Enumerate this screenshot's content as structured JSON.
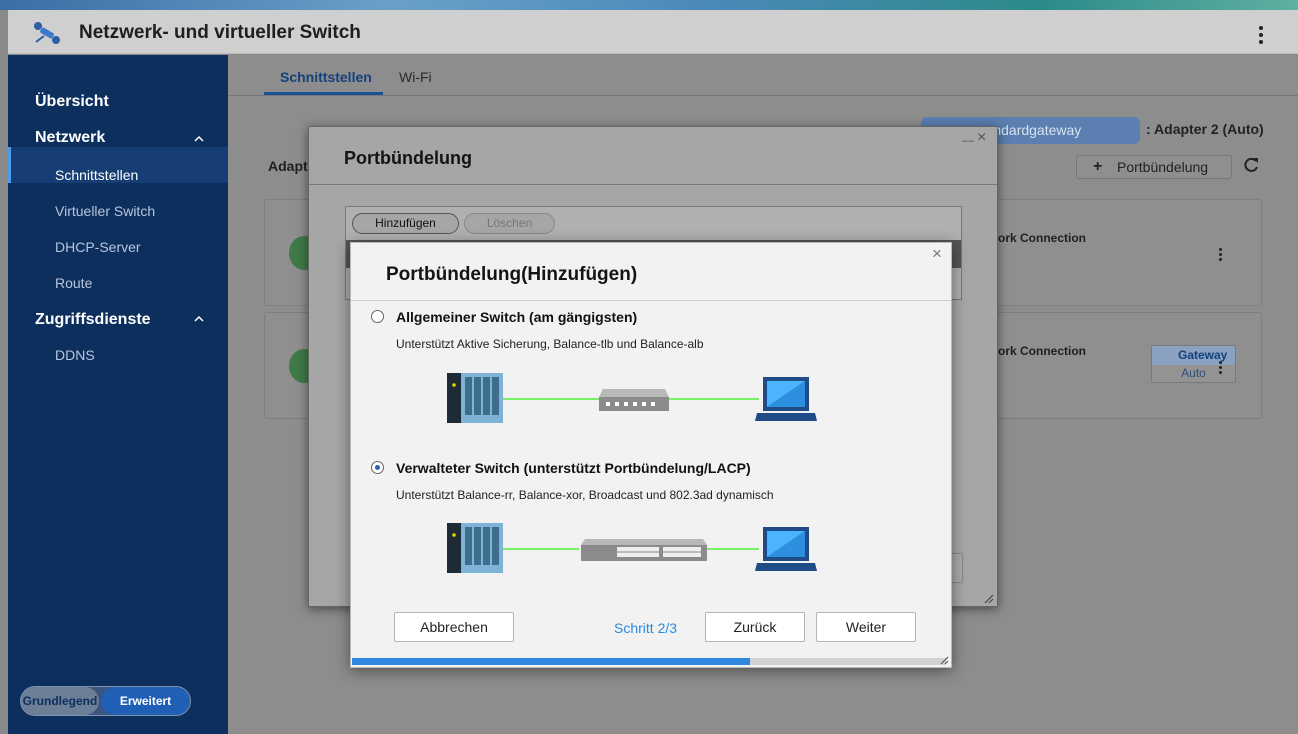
{
  "app": {
    "title": "Netzwerk- und virtueller Switch"
  },
  "sidebar": {
    "sections": [
      {
        "label": "Übersicht"
      },
      {
        "label": "Netzwerk"
      },
      {
        "label": "Zugriffsdienste"
      }
    ],
    "items": [
      {
        "label": "Schnittstellen",
        "active": true
      },
      {
        "label": "Virtueller Switch"
      },
      {
        "label": "DHCP-Server"
      },
      {
        "label": "Route"
      },
      {
        "label": "DDNS"
      }
    ],
    "mode_toggle": {
      "left": "Grundlegend",
      "right": "Erweitert",
      "selected": "Erweitert"
    }
  },
  "main": {
    "tabs": [
      {
        "label": "Schnittstellen",
        "active": true
      },
      {
        "label": "Wi-Fi"
      }
    ],
    "gateway_label": "mstandardgateway",
    "gateway_value": ": Adapter 2 (Auto)",
    "add_button": "Portbündelung",
    "adapter_heading": "Adapt",
    "cards": [
      {
        "connection": "ork Connection"
      },
      {
        "connection": "ork Connection",
        "badge_title": "Gateway",
        "badge_sub": "Auto"
      }
    ]
  },
  "dialog_bond": {
    "title": "Portbündelung",
    "add_button": "Hinzufügen",
    "delete_button": "Löschen"
  },
  "dialog_add": {
    "title": "Portbündelung(Hinzufügen)",
    "options": [
      {
        "title": "Allgemeiner Switch (am gängigsten)",
        "desc": "Unterstützt Aktive Sicherung, Balance-tlb und Balance-alb",
        "selected": false
      },
      {
        "title": "Verwalteter Switch (unterstützt Portbündelung/LACP)",
        "desc": "Unterstützt Balance-rr, Balance-xor, Broadcast und 802.3ad dynamisch",
        "selected": true
      }
    ],
    "cancel_button": "Abbrechen",
    "step_text": "Schritt 2/3",
    "back_button": "Zurück",
    "next_button": "Weiter",
    "progress": 0.67
  },
  "colors": {
    "sidebar": "#0d2f5e",
    "accent": "#2e88e0",
    "link_line": "#7bef6a"
  }
}
